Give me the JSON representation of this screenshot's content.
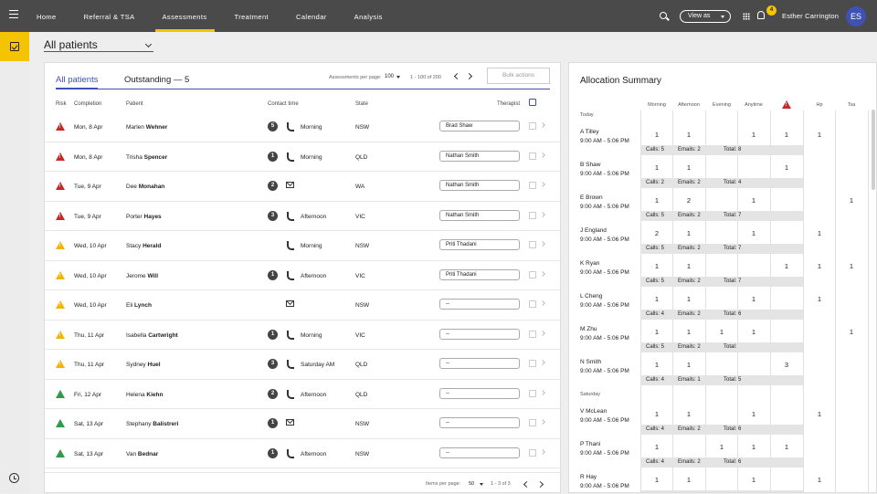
{
  "nav": {
    "items": [
      "Home",
      "Referral & TSA",
      "Assessments",
      "Treatment",
      "Calendar",
      "Analysis"
    ],
    "active": "Assessments",
    "view_as": "View as",
    "notification_count": "4",
    "user_name": "Esther Carrington",
    "user_initials": "ES"
  },
  "patient_filter": "All patients",
  "list": {
    "tabs": [
      "All patients",
      "Outstanding — 5"
    ],
    "per_page_label": "Assessments per page:",
    "per_page_value": "100",
    "range": "1 - 100 of 200",
    "bulk_actions": "Bulk actions",
    "columns": [
      "Risk",
      "Completion",
      "Patient",
      "Contact time",
      "State",
      "Therapist"
    ],
    "rows": [
      {
        "risk": "high",
        "date": "Mon, 8 Apr",
        "first": "Marlen",
        "last": "Wehner",
        "count": "5",
        "contact": "phone",
        "time": "Morning",
        "state": "NSW",
        "therapist": "Brad Shaw"
      },
      {
        "risk": "high",
        "date": "Mon, 8 Apr",
        "first": "Trisha",
        "last": "Spencer",
        "count": "1",
        "contact": "phone",
        "time": "Morning",
        "state": "QLD",
        "therapist": "Nathan Smith"
      },
      {
        "risk": "high",
        "date": "Tue, 9 Apr",
        "first": "Dee",
        "last": "Monahan",
        "count": "2",
        "contact": "mail",
        "time": "",
        "state": "WA",
        "therapist": "Nathan Smith"
      },
      {
        "risk": "high",
        "date": "Tue, 9 Apr",
        "first": "Porter",
        "last": "Hayes",
        "count": "3",
        "contact": "phone",
        "time": "Afternoon",
        "state": "VIC",
        "therapist": "Nathan Smith"
      },
      {
        "risk": "medium",
        "date": "Wed, 10 Apr",
        "first": "Stacy",
        "last": "Herald",
        "count": "",
        "contact": "phone",
        "time": "Morning",
        "state": "NSW",
        "therapist": "Priti Thadani"
      },
      {
        "risk": "medium",
        "date": "Wed, 10 Apr",
        "first": "Jerome",
        "last": "Will",
        "count": "1",
        "contact": "phone",
        "time": "Afternoon",
        "state": "VIC",
        "therapist": "Priti Thadani"
      },
      {
        "risk": "medium",
        "date": "Wed, 10 Apr",
        "first": "Eli",
        "last": "Lynch",
        "count": "",
        "contact": "mail",
        "time": "",
        "state": "NSW",
        "therapist": "--"
      },
      {
        "risk": "medium",
        "date": "Thu, 11 Apr",
        "first": "Isabella",
        "last": "Cartwright",
        "count": "1",
        "contact": "phone",
        "time": "Morning",
        "state": "VIC",
        "therapist": "--"
      },
      {
        "risk": "medium",
        "date": "Thu, 11 Apr",
        "first": "Sydney",
        "last": "Huel",
        "count": "3",
        "contact": "phone",
        "time": "Saturday AM",
        "state": "QLD",
        "therapist": "--"
      },
      {
        "risk": "low",
        "date": "Fri, 12 Apr",
        "first": "Helena",
        "last": "Kiehn",
        "count": "2",
        "contact": "phone",
        "time": "Afternoon",
        "state": "QLD",
        "therapist": "--"
      },
      {
        "risk": "low",
        "date": "Sat, 13 Apr",
        "first": "Stephany",
        "last": "Balistreri",
        "count": "1",
        "contact": "mail",
        "time": "",
        "state": "NSW",
        "therapist": "--"
      },
      {
        "risk": "low",
        "date": "Sat, 13 Apr",
        "first": "Van",
        "last": "Bednar",
        "count": "1",
        "contact": "phone",
        "time": "Afternoon",
        "state": "NSW",
        "therapist": "--"
      }
    ],
    "footer": {
      "items_label": "Items per page:",
      "items_value": "50",
      "range": "1 - 3 of 3"
    }
  },
  "allocation": {
    "title": "Allocation Summary",
    "columns": [
      "Morning",
      "Afternoon",
      "Evening",
      "Anytime",
      "",
      "Hp",
      "Tsa"
    ],
    "rows": [
      {
        "day": "Today",
        "name": "A Tilley",
        "hours": "9:00 AM - 5:06 PM",
        "v": [
          "1",
          "1",
          "",
          "1",
          "1",
          "1",
          ""
        ],
        "calls": "Calls: 5",
        "emails": "Emails: 2",
        "total": "Total: 8"
      },
      {
        "day": "",
        "name": "B Shaw",
        "hours": "9:00 AM - 5:06 PM",
        "v": [
          "1",
          "1",
          "",
          "",
          "1",
          "",
          ""
        ],
        "calls": "Calls: 2",
        "emails": "Emails: 2",
        "total": "Total: 4"
      },
      {
        "day": "",
        "name": "E Brown",
        "hours": "9:00 AM - 5:06 PM",
        "v": [
          "1",
          "2",
          "",
          "1",
          "",
          "",
          "1"
        ],
        "calls": "Calls: 5",
        "emails": "Emails: 2",
        "total": "Total: 7"
      },
      {
        "day": "",
        "name": "J England",
        "hours": "9:00 AM - 5:06 PM",
        "v": [
          "2",
          "1",
          "",
          "1",
          "",
          "1",
          ""
        ],
        "calls": "Calls: 5",
        "emails": "Emails: 2",
        "total": "Total: 7"
      },
      {
        "day": "",
        "name": "K Ryan",
        "hours": "9:00 AM - 5:06 PM",
        "v": [
          "1",
          "1",
          "",
          "",
          "1",
          "1",
          "1"
        ],
        "calls": "Calls: 5",
        "emails": "Emails: 2",
        "total": "Total: 7"
      },
      {
        "day": "",
        "name": "L Cheng",
        "hours": "9:00 AM - 5:06 PM",
        "v": [
          "1",
          "1",
          "",
          "1",
          "",
          "1",
          ""
        ],
        "calls": "Calls: 4",
        "emails": "Emails: 2",
        "total": "Total: 6"
      },
      {
        "day": "",
        "name": "M Zhu",
        "hours": "9:00 AM - 5:06 PM",
        "v": [
          "1",
          "1",
          "1",
          "1",
          "",
          "",
          "1"
        ],
        "calls": "Calls: 5",
        "emails": "Emails: 2",
        "total": "Total:"
      },
      {
        "day": "",
        "name": "N Smith",
        "hours": "9:00 AM - 5:06 PM",
        "v": [
          "1",
          "1",
          "",
          "",
          "3",
          "",
          ""
        ],
        "calls": "Calls: 4",
        "emails": "Emails: 1",
        "total": "Total: 5"
      },
      {
        "day": "Saturday",
        "name": "V McLean",
        "hours": "9:00 AM - 5:06 PM",
        "v": [
          "1",
          "1",
          "",
          "1",
          "",
          "1",
          ""
        ],
        "calls": "Calls: 4",
        "emails": "Emails: 2",
        "total": "Total: 6"
      },
      {
        "day": "",
        "name": "P Thani",
        "hours": "9:00 AM - 5:06 PM",
        "v": [
          "1",
          "",
          "1",
          "1",
          "1",
          "",
          ""
        ],
        "calls": "Calls: 4",
        "emails": "Emails: 2",
        "total": "Total: 6"
      },
      {
        "day": "",
        "name": "R Hay",
        "hours": "9:00 AM - 5:06 PM",
        "v": [
          "1",
          "1",
          "",
          "1",
          "",
          "1",
          ""
        ],
        "calls": "Calls: 4",
        "emails": "Emails: 2",
        "total": "Total: 6"
      }
    ]
  }
}
